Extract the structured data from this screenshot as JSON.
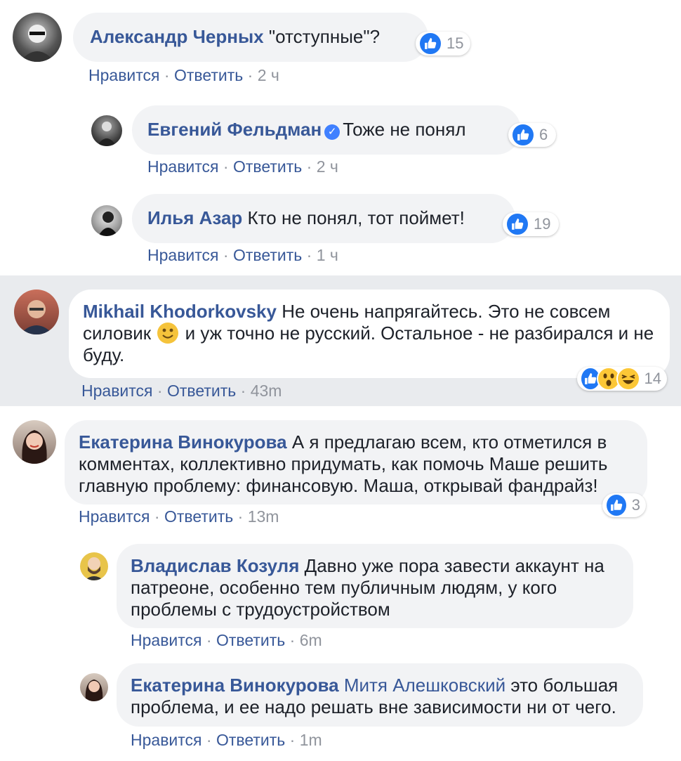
{
  "comments": [
    {
      "author": "Александр Черных",
      "text": "\"отступные\"?",
      "like_label": "Нравится",
      "reply_label": "Ответить",
      "time": "2 ч",
      "reactions": "15"
    },
    {
      "author": "Евгений Фельдман",
      "text": "Тоже не понял",
      "like_label": "Нравится",
      "reply_label": "Ответить",
      "time": "2 ч",
      "reactions": "6"
    },
    {
      "author": "Илья Азар",
      "text": "Кто не понял, тот поймет!",
      "like_label": "Нравится",
      "reply_label": "Ответить",
      "time": "1 ч",
      "reactions": "19"
    },
    {
      "author": "Mikhail Khodorkovsky",
      "text_before": "Не очень напрягайтесь. Это не совсем силовик",
      "text_after": "и уж точно не русский. Остальное - не разбирался и не буду.",
      "like_label": "Нравится",
      "reply_label": "Ответить",
      "time": "43m",
      "reactions": "14"
    },
    {
      "author": "Екатерина Винокурова",
      "text": "А я предлагаю всем, кто отметился в комментах, коллективно придумать, как помочь Маше решить главную проблему: финансовую. Маша, открывай фандрайз!",
      "like_label": "Нравится",
      "reply_label": "Ответить",
      "time": "13m",
      "reactions": "3"
    },
    {
      "author": "Владислав Козуля",
      "text": "Давно уже пора завести аккаунт на патреоне, особенно тем публичным людям, у кого проблемы с трудоустройством",
      "like_label": "Нравится",
      "reply_label": "Ответить",
      "time": "6m"
    },
    {
      "author": "Екатерина Винокурова",
      "mention": "Митя Алешковский",
      "text": "это большая проблема, и ее надо решать вне зависимости ни от чего.",
      "like_label": "Нравится",
      "reply_label": "Ответить",
      "time": "1m"
    }
  ],
  "colors": {
    "name": "#385898",
    "bubble": "#f2f3f5",
    "meta": "#90949c",
    "like": "#2078f4",
    "band_bg": "#e9ebee"
  }
}
